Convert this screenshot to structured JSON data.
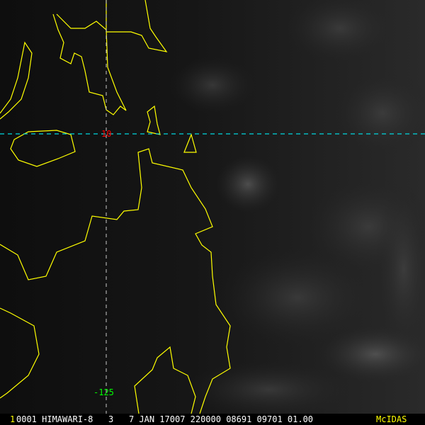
{
  "image": {
    "satellite": "HIMAWARI-8",
    "grid_labels": {
      "latitude": "10",
      "longitude": "-125"
    },
    "footer": {
      "frame": "1",
      "text": "0001 HIMAWARI-8   3   7 JAN 17007 220000 08691 09701 01.00",
      "brand": "McIDAS"
    },
    "colors": {
      "coast": "#ffff00",
      "lat_line": "#00d8e0",
      "lon_line": "#c8c8c8",
      "lat_label": "#ff0000",
      "lon_label": "#00ff00"
    }
  }
}
